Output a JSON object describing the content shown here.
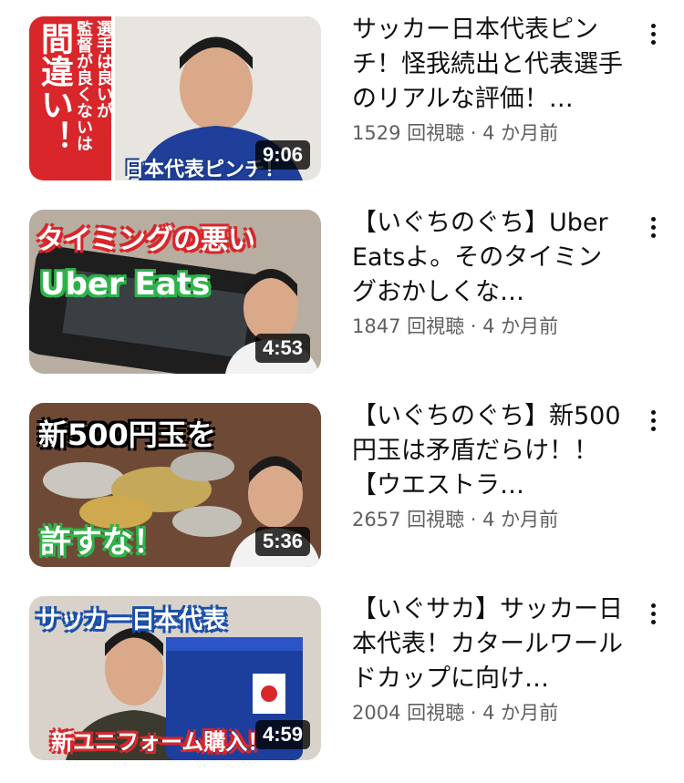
{
  "videos": [
    {
      "title": "サッカー日本代表ピンチ！怪我続出と代表選手のリアルな評価！…",
      "meta": "1529 回視聴 · 4 か月前",
      "duration": "9:06",
      "thumb": {
        "left_caption": "間違い！",
        "middle_caption": "監督が良くないは",
        "middle_caption_2": "選手は良いが",
        "bottom_caption": "日本代表ピンチ！",
        "accent": "#d8262b"
      }
    },
    {
      "title": "【いぐちのぐち】Uber Eatsよ。そのタイミングおかしくな…",
      "meta": "1847 回視聴 · 4 か月前",
      "duration": "4:53",
      "thumb": {
        "top_caption": "タイミングの悪い",
        "mid_caption": "Uber Eats",
        "accent": "#d8262b",
        "accent2": "#2db34a"
      }
    },
    {
      "title": "【いぐちのぐち】新500円玉は矛盾だらけ！！【ウエストラ…",
      "meta": "2657 回視聴 · 4 か月前",
      "duration": "5:36",
      "thumb": {
        "top_caption": "新500円玉を",
        "bottom_caption": "許すな！",
        "accent": "#2db34a"
      }
    },
    {
      "title": "【いぐサカ】サッカー日本代表！カタールワールドカップに向け…",
      "meta": "2004 回視聴 · 4 か月前",
      "duration": "4:59",
      "thumb": {
        "top_caption": "サッカー日本代表",
        "bottom_caption": "新ユニフォーム購入！",
        "accent": "#1a4fa8"
      }
    }
  ],
  "icons": {
    "more": "more-vert-icon"
  }
}
